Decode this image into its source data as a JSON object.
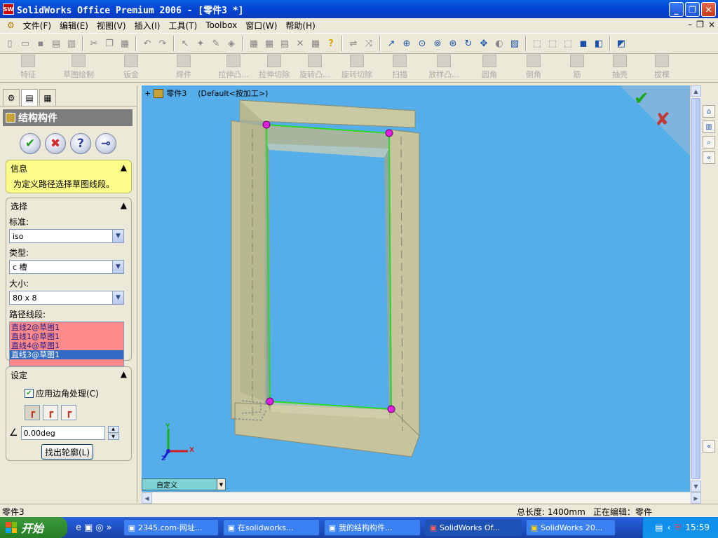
{
  "window": {
    "title": "SolidWorks Office Premium 2006 - [零件3 *]",
    "app_icon_text": "SW",
    "minimize": "_",
    "maximize": "❐",
    "close": "✕"
  },
  "menu": [
    {
      "label": "文件(F)"
    },
    {
      "label": "编辑(E)"
    },
    {
      "label": "视图(V)"
    },
    {
      "label": "插入(I)"
    },
    {
      "label": "工具(T)"
    },
    {
      "label": "Toolbox"
    },
    {
      "label": "窗口(W)"
    },
    {
      "label": "帮助(H)"
    }
  ],
  "mdi": {
    "min": "–",
    "restore": "❐",
    "close": "×"
  },
  "feature_toolbar": [
    {
      "label": "特征"
    },
    {
      "label": "草图绘制"
    },
    {
      "label": "钣金"
    },
    {
      "label": "焊件"
    },
    {
      "label": "拉伸凸..."
    },
    {
      "label": "拉伸切除"
    },
    {
      "label": "旋转凸..."
    },
    {
      "label": "旋转切除"
    },
    {
      "label": "扫描"
    },
    {
      "label": "放样凸..."
    },
    {
      "label": "圆角"
    },
    {
      "label": "倒角"
    },
    {
      "label": "筋"
    },
    {
      "label": "抽壳"
    },
    {
      "label": "拔模"
    }
  ],
  "panel": {
    "title": "结构构件",
    "ok": "✔",
    "cancel": "✖",
    "help": "?",
    "pin": "⊸",
    "info": {
      "header": "信息",
      "text": "为定义路径选择草图线段。",
      "collapse": "▲"
    },
    "selection": {
      "header": "选择",
      "collapse": "▲",
      "standard_label": "标准:",
      "standard_value": "iso",
      "type_label": "类型:",
      "type_value": "c 槽",
      "size_label": "大小:",
      "size_value": "80 x 8",
      "path_label": "路径线段:",
      "path_items": [
        {
          "label": "直线2@草图1"
        },
        {
          "label": "直线1@草图1"
        },
        {
          "label": "直线4@草图1"
        },
        {
          "label": "直线3@草图1"
        }
      ],
      "selected_path_index": 3
    },
    "settings": {
      "header": "设定",
      "collapse": "▲",
      "corner_check_label": "应用边角处理(C)",
      "corner_checked": true,
      "angle_value": "0.00deg",
      "locate_button": "找出轮廓(L)"
    }
  },
  "viewport": {
    "tree_root": "零件3",
    "tree_config": "(Default<按加工>)",
    "tree_expand": "+",
    "axis_x": "X",
    "axis_y": "Y",
    "axis_z": "Z",
    "background": "#55aeea",
    "confirm_ok": "✔",
    "confirm_cancel": "✘"
  },
  "view_combo": {
    "value": "自定义"
  },
  "status": {
    "left": "零件3",
    "total_length": "总长度: 1400mm",
    "editing": "正在编辑：零件"
  },
  "taskbar": {
    "start_label": "开始",
    "quicklaunch": [
      "e",
      "▣",
      "◎",
      "»"
    ],
    "tasks": [
      {
        "label": "2345.com-网址..."
      },
      {
        "label": "在solidworks..."
      },
      {
        "label": "我的结构构件..."
      },
      {
        "label": "SolidWorks Of..."
      },
      {
        "label": "SolidWorks 20..."
      }
    ],
    "active_task_index": 3,
    "clock": "15:59"
  }
}
